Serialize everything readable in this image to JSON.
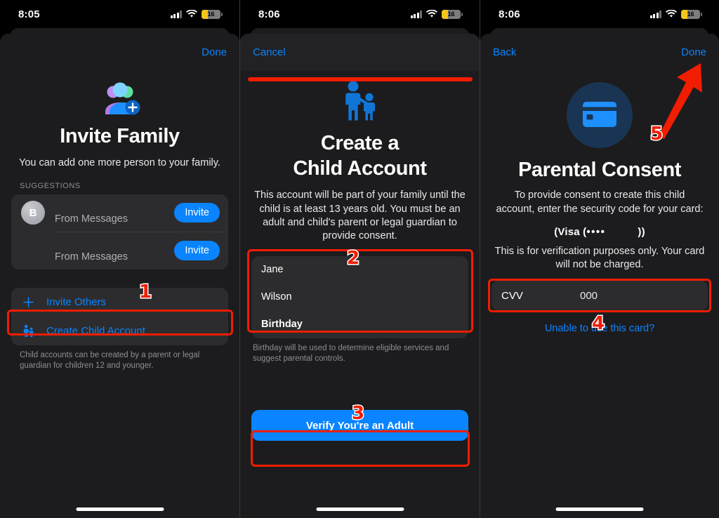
{
  "panels": [
    {
      "status": {
        "time": "8:05",
        "battery": "16"
      },
      "nav": {
        "right_label": "Done"
      },
      "icon": "family-add-icon",
      "title": "Invite Family",
      "subtitle": "You can add one more person to your family.",
      "section_label": "SUGGESTIONS",
      "suggestions": [
        {
          "initial": "B",
          "name": "From Messages",
          "button": "Invite"
        },
        {
          "initial": "",
          "name": "From Messages",
          "button": "Invite"
        }
      ],
      "actions": [
        {
          "icon": "plus-icon",
          "label": "Invite Others"
        },
        {
          "icon": "child-account-icon",
          "label": "Create Child Account"
        }
      ],
      "footnote": "Child accounts can be created by a parent or legal guardian for children 12 and younger."
    },
    {
      "status": {
        "time": "8:06",
        "battery": "16"
      },
      "nav": {
        "left_label": "Cancel"
      },
      "icon": "parent-child-icon",
      "title_line1": "Create a",
      "title_line2": "Child Account",
      "subtitle": "This account will be part of your family until the child is at least 13 years old. You must be an adult and child's parent or legal guardian to provide consent.",
      "form_rows": [
        {
          "value": "Jane",
          "bold": false
        },
        {
          "value": "Wilson",
          "bold": false
        },
        {
          "value": "Birthday",
          "bold": true
        }
      ],
      "form_footnote": "Birthday will be used to determine eligible services and suggest parental controls.",
      "primary_button": "Verify You're an Adult"
    },
    {
      "status": {
        "time": "8:06",
        "battery": "16"
      },
      "nav": {
        "left_label": "Back",
        "right_label": "Done"
      },
      "icon": "credit-card-icon",
      "title": "Parental Consent",
      "subtitle": "To provide consent to create this child account, enter the security code for your card:",
      "card_brand_prefix": "(Visa (",
      "card_brand_dots": "••••",
      "card_brand_suffix": "))",
      "disclaimer": "This is for verification purposes only. Your card will not be charged.",
      "cvv_label": "CVV",
      "cvv_value": "000",
      "help_link": "Unable to use this card?"
    }
  ],
  "annotations": {
    "step1": "1",
    "step2": "2",
    "step3": "3",
    "step4": "4",
    "step5": "5",
    "highlight_color": "#f01d00"
  }
}
